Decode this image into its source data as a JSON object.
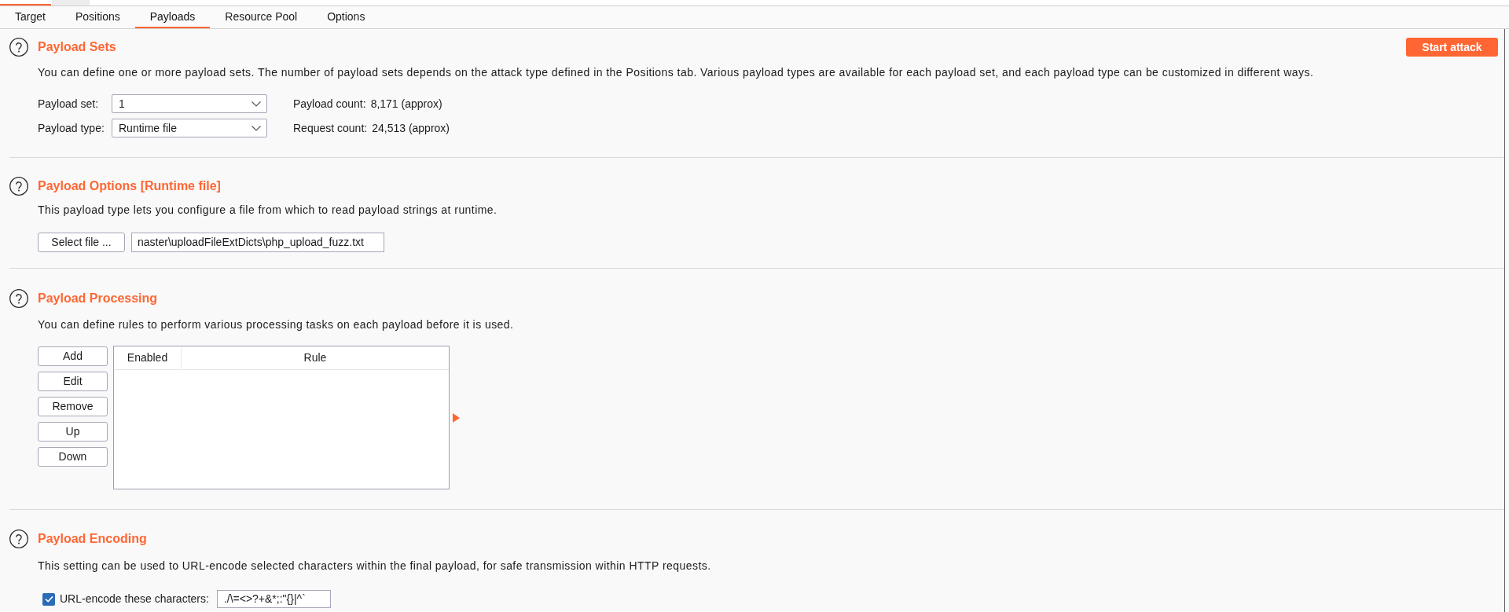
{
  "outer_tabs": [
    {
      "selected": true
    },
    {
      "selected": false
    }
  ],
  "tabs": [
    {
      "label": "Target",
      "selected": false
    },
    {
      "label": "Positions",
      "selected": false
    },
    {
      "label": "Payloads",
      "selected": true
    },
    {
      "label": "Resource Pool",
      "selected": false
    },
    {
      "label": "Options",
      "selected": false
    }
  ],
  "payload_sets": {
    "title": "Payload Sets",
    "description": "You can define one or more payload sets. The number of payload sets depends on the attack type defined in the Positions tab. Various payload types are available for each payload set, and each payload type can be customized in different ways.",
    "start_button": "Start attack",
    "fields": [
      {
        "label": "Payload set:",
        "value": "1",
        "info_label": "Payload count:",
        "info_value": "8,171 (approx)"
      },
      {
        "label": "Payload type:",
        "value": "Runtime file",
        "info_label": "Request count:",
        "info_value": "24,513 (approx)"
      }
    ]
  },
  "payload_options": {
    "title": "Payload Options [Runtime file]",
    "description": "This payload type lets you configure a file from which to read payload strings at runtime.",
    "select_button": "Select file ...",
    "file_path": "naster\\uploadFileExtDicts\\php_upload_fuzz.txt"
  },
  "payload_processing": {
    "title": "Payload Processing",
    "description": "You can define rules to perform various processing tasks on each payload before it is used.",
    "buttons": [
      "Add",
      "Edit",
      "Remove",
      "Up",
      "Down"
    ],
    "table": {
      "columns": [
        "Enabled",
        "Rule"
      ]
    }
  },
  "payload_encoding": {
    "title": "Payload Encoding",
    "description": "This setting can be used to URL-encode selected characters within the final payload, for safe transmission within HTTP requests.",
    "checkbox": {
      "label": "URL-encode these characters:",
      "checked": true
    },
    "characters": "./\\=<>?+&*;:\"{}|^`"
  }
}
